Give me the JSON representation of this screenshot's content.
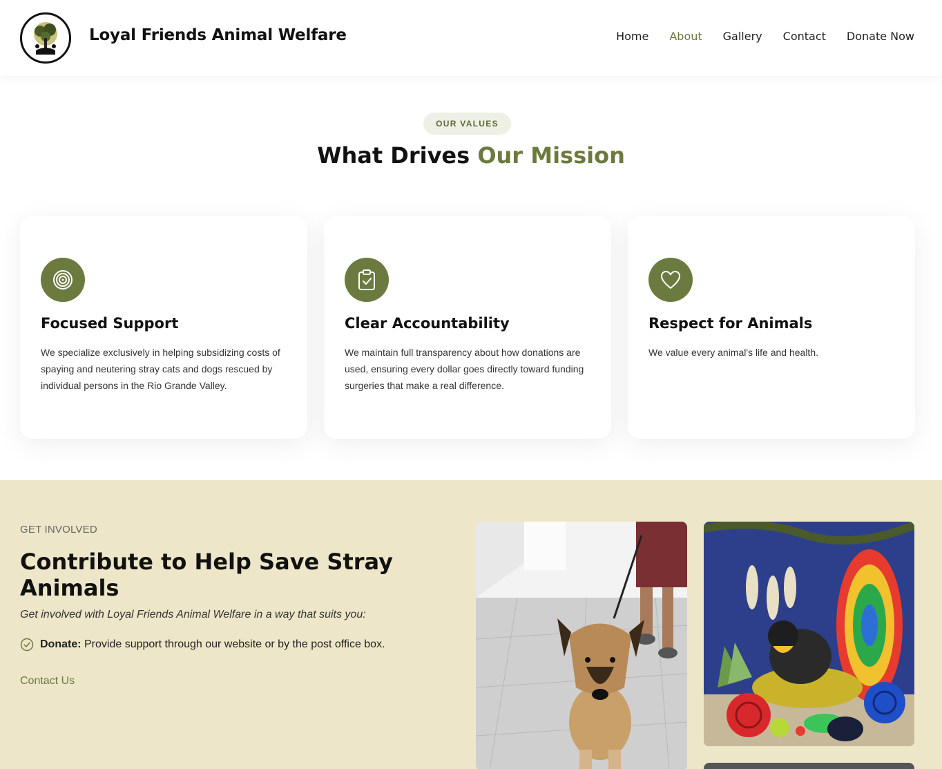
{
  "header": {
    "site_title": "Loyal Friends Animal Welfare",
    "logo_text": "LOYAL FRIENDS ANIMAL WELFARE",
    "nav": [
      {
        "label": "Home",
        "active": false
      },
      {
        "label": "About",
        "active": true
      },
      {
        "label": "Gallery",
        "active": false
      },
      {
        "label": "Contact",
        "active": false
      },
      {
        "label": "Donate Now",
        "active": false
      }
    ]
  },
  "values": {
    "pill": "OUR VALUES",
    "title_main": "What Drives ",
    "title_accent": "Our Mission",
    "cards": [
      {
        "icon": "target-icon",
        "title": "Focused Support",
        "text": "We specialize exclusively in helping subsidizing costs of spaying and neutering stray cats and dogs rescued by individual persons in the Rio Grande Valley."
      },
      {
        "icon": "clipboard-check-icon",
        "title": "Clear Accountability",
        "text": "We maintain full transparency about how donations are used, ensuring every dollar goes directly toward funding surgeries that make a real difference."
      },
      {
        "icon": "heart-icon",
        "title": "Respect for Animals",
        "text": "We value every animal's life and health."
      }
    ]
  },
  "involved": {
    "kicker": "GET INVOLVED",
    "title": "Contribute to Help Save Stray Animals",
    "subtitle": "Get involved with Loyal Friends Animal Welfare in a way that suits you:",
    "donate_label": "Donate:",
    "donate_text": " Provide support through our website or by the post office box.",
    "contact_link": "Contact Us"
  },
  "colors": {
    "accent": "#6b7a3f",
    "involved_bg": "#ede6c8",
    "pill_bg": "#eef0e6"
  }
}
